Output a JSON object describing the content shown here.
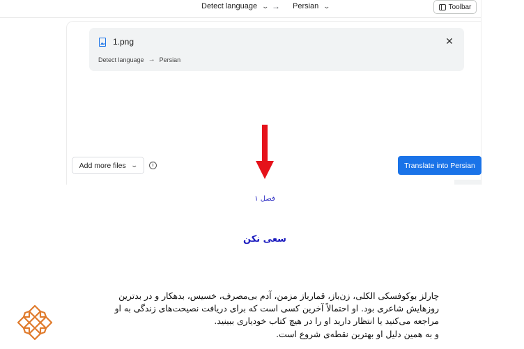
{
  "toolbar": {
    "source_lang": "Detect language",
    "target_lang": "Persian",
    "toolbar_label": "Toolbar"
  },
  "file": {
    "name": "1.png",
    "source_lang": "Detect language",
    "target_lang": "Persian"
  },
  "actions": {
    "add_files_label": "Add more files",
    "translate_label": "Translate into Persian"
  },
  "colors": {
    "accent": "#1a73e8",
    "arrow": "#e5121b",
    "doc_heading": "#1d1dbf",
    "logo": "#e07b2c"
  },
  "document": {
    "chapter": "فصل ۱",
    "heading": "سعی نکن",
    "lines": [
      "چارلز بوکوفسکی الکلی، زن‌باز، قمارباز مزمن، آدم بی‌مصرف، خسیس، بدهکار و در بدترین",
      "روزهایش شاعری بود. او احتمالاً آخرین کسی است که برای دریافت نصیحت‌های زندگی به او",
      "مراجعه می‌کنید یا انتظار دارید او را در هیچ کتاب خودیاری ببینید.",
      "و به همین دلیل او بهترین نقطه‌ی شروع است."
    ]
  },
  "icons": {
    "file": "image-file-icon",
    "close": "close-icon",
    "info": "info-icon",
    "toolbar": "sidebar-panel-icon",
    "chevron": "chevron-down-icon",
    "arrow_right": "arrow-right-icon"
  }
}
